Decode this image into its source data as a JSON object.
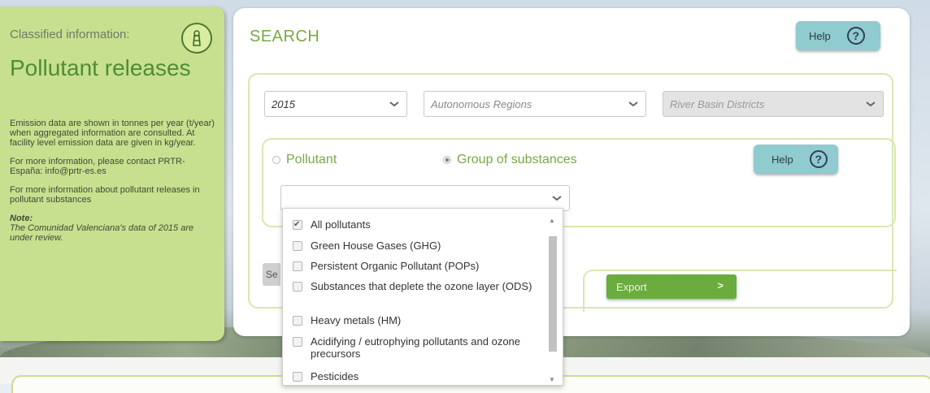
{
  "info": {
    "classified_label": "Classified information:",
    "title": "Pollutant releases",
    "paragraph1": "Emission data are shown in tonnes per year (t/year) when aggregated information are consulted. At facility level emission data are given in kg/year.",
    "paragraph2": "For more information, please contact PRTR-España: info@prtr-es.es",
    "paragraph3": "For more information about pollutant releases in pollutant substances",
    "note_label": "Note:",
    "note_text": "The Comunidad Valenciana's data of 2015 are under review."
  },
  "search": {
    "title": "SEARCH",
    "help_label": "Help",
    "help_icon": "?",
    "year": "2015",
    "region_placeholder": "Autonomous Regions",
    "basin_placeholder": "River Basin Districts",
    "radio_pollutant": "Pollutant",
    "radio_group": "Group of substances",
    "inner_help_label": "Help",
    "substance_value": "",
    "search_button_partial": "Se",
    "export_label": "Export",
    "export_arrow": ">"
  },
  "dropdown": {
    "items": [
      {
        "label": "All pollutants",
        "checked": true
      },
      {
        "label": "Green House Gases (GHG)",
        "checked": false
      },
      {
        "label": "Persistent Organic Pollutant (POPs)",
        "checked": false
      },
      {
        "label": "Substances that deplete the ozone layer (ODS)",
        "checked": false
      },
      {
        "label": "Heavy metals (HM)",
        "checked": false
      },
      {
        "label": "Acidifying / eutrophying pollutants and ozone precursors",
        "checked": false
      },
      {
        "label": "Pesticides",
        "checked": false
      }
    ]
  },
  "colors": {
    "accent_green": "#7aa844",
    "panel_green": "#c7e08f",
    "help_teal": "#8fcbcf",
    "export_green": "#6aac3e"
  },
  "icons": {
    "info_icon": "factory-icon",
    "chevron": "chevron-down-icon",
    "help": "question-circle-icon"
  }
}
